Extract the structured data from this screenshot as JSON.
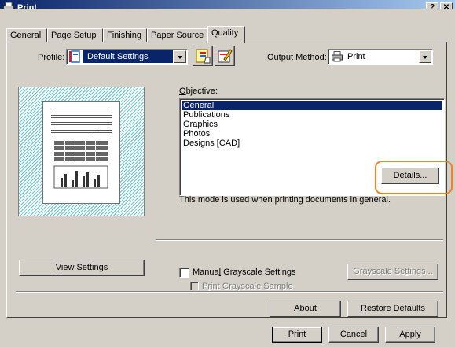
{
  "window": {
    "title": "Print",
    "help_label": "?",
    "close_label": "✕"
  },
  "tabs": [
    {
      "label": "General"
    },
    {
      "label": "Page Setup"
    },
    {
      "label": "Finishing"
    },
    {
      "label": "Paper Source"
    },
    {
      "label": "Quality",
      "active": true
    }
  ],
  "profile": {
    "label_pre": "Pro",
    "label_u": "f",
    "label_post": "ile:",
    "value": "Default Settings",
    "icon": "profile-icon"
  },
  "output_method": {
    "label_pre": "Output ",
    "label_u": "M",
    "label_post": "ethod:",
    "value": "Print",
    "icon": "printer-icon"
  },
  "objective": {
    "label_u": "O",
    "label_post": "bjective:",
    "items": [
      "General",
      "Publications",
      "Graphics",
      "Photos",
      "Designs [CAD]"
    ],
    "selected": "General",
    "description": "This mode is used when printing documents in general."
  },
  "buttons": {
    "details": {
      "pre": "Detai",
      "u": "l",
      "post": "s..."
    },
    "view_settings": {
      "pre": "",
      "u": "V",
      "post": "iew Settings"
    },
    "grayscale_settings": {
      "pre": "Grayscale Se",
      "u": "t",
      "post": "tings..."
    },
    "about": {
      "pre": "A",
      "u": "b",
      "post": "out"
    },
    "restore_defaults": {
      "pre": "",
      "u": "R",
      "post": "estore Defaults"
    },
    "print": {
      "pre": "",
      "u": "P",
      "post": "rint"
    },
    "cancel": {
      "pre": "Cancel",
      "u": "",
      "post": ""
    },
    "apply": {
      "pre": "",
      "u": "A",
      "post": "pply"
    }
  },
  "manual_grayscale": {
    "pre": "Manua",
    "u": "l",
    "post": " Grayscale Settings",
    "checked": false
  },
  "print_grayscale_sample": {
    "pre": "P",
    "u": "r",
    "post": "int Grayscale Sample",
    "checked": false,
    "disabled": true
  },
  "colors": {
    "accent": "#f08223",
    "titlebar": "#0a246a",
    "selection": "#0a246a",
    "preview_hatch": "#5ec4d3"
  }
}
